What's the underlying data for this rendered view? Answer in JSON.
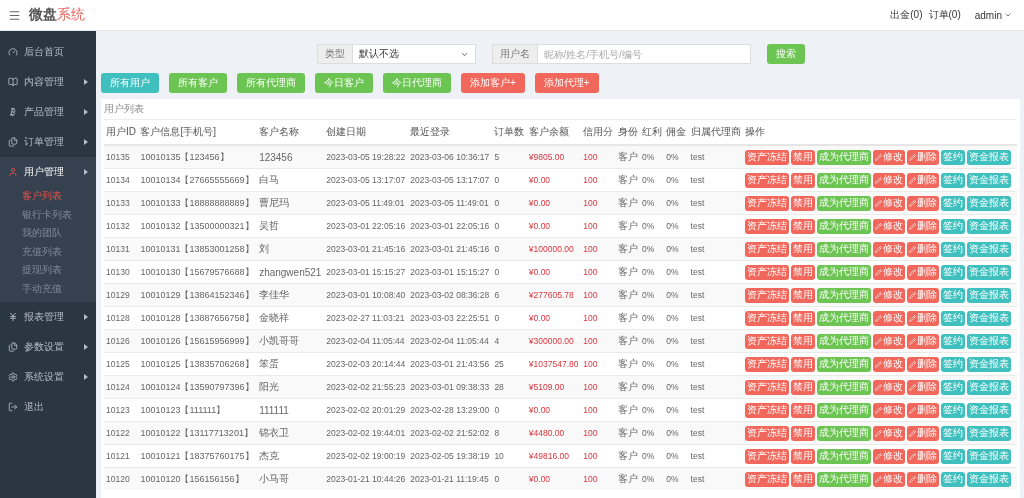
{
  "header": {
    "logo": {
      "main": "微盘",
      "accent": "系统"
    },
    "links": [
      "出金(0)",
      "订单(0)"
    ],
    "user": "admin"
  },
  "sidebar": {
    "items": [
      {
        "label": "后台首页",
        "expandable": false,
        "expanded": false
      },
      {
        "label": "内容管理",
        "expandable": true,
        "expanded": false
      },
      {
        "label": "产品管理",
        "expandable": true,
        "expanded": false
      },
      {
        "label": "订单管理",
        "expandable": true,
        "expanded": false
      },
      {
        "label": "用户管理",
        "expandable": true,
        "expanded": true,
        "children": [
          {
            "label": "客户列表",
            "selected": true
          },
          {
            "label": "银行卡列表",
            "selected": false
          },
          {
            "label": "我的团队",
            "selected": false
          },
          {
            "label": "充值列表",
            "selected": false
          },
          {
            "label": "提现列表",
            "selected": false
          },
          {
            "label": "手动充值",
            "selected": false
          }
        ]
      },
      {
        "label": "报表管理",
        "expandable": true,
        "expanded": false
      },
      {
        "label": "参数设置",
        "expandable": true,
        "expanded": false
      },
      {
        "label": "系统设置",
        "expandable": true,
        "expanded": false
      },
      {
        "label": "退出",
        "expandable": false,
        "expanded": false
      }
    ]
  },
  "filter": {
    "type_label": "类型",
    "type_value": "默认不选",
    "name_label": "用户名",
    "placeholder": "昵称/姓名/手机号/编号",
    "search": "搜索"
  },
  "quick_buttons": [
    {
      "label": "所有用户",
      "kind": "info"
    },
    {
      "label": "所有客户",
      "kind": "ok"
    },
    {
      "label": "所有代理商",
      "kind": "ok"
    },
    {
      "label": "今日客户",
      "kind": "ok"
    },
    {
      "label": "今日代理商",
      "kind": "ok"
    },
    {
      "label": "添加客户+",
      "kind": "warn"
    },
    {
      "label": "添加代理+",
      "kind": "warn"
    }
  ],
  "table": {
    "title": "用户列表",
    "columns": [
      "用户ID",
      "客户信息[手机号]",
      "客户名称",
      "创建日期",
      "最近登录",
      "订单数",
      "客户余额",
      "信用分",
      "身份",
      "红利",
      "佣金",
      "归属代理商",
      "操作"
    ],
    "rows": [
      {
        "cells": [
          "10135",
          "10010135【123456】",
          "123456",
          "2023-03-05 19:28:22",
          "2023-03-06 10:36:17",
          "5",
          "¥9805.00",
          "100",
          "客户",
          "0%",
          "0%",
          "test"
        ],
        "actions": [
          {
            "label": "资产冻结",
            "kind": "warn"
          },
          {
            "label": "禁用",
            "kind": "warn"
          },
          {
            "label": "成为代理商",
            "kind": "ok"
          },
          {
            "label": "修改",
            "kind": "edit"
          },
          {
            "label": "删除",
            "kind": "edit"
          },
          {
            "label": "签约",
            "kind": "info"
          },
          {
            "label": "资金报表",
            "kind": "info"
          }
        ]
      },
      {
        "cells": [
          "10134",
          "10010134【27665555669】",
          "白马",
          "2023-03-05 13:17:07",
          "2023-03-05 13:17:07",
          "0",
          "¥0.00",
          "100",
          "客户",
          "0%",
          "0%",
          "test"
        ],
        "actions": [
          {
            "label": "资产冻结",
            "kind": "warn"
          },
          {
            "label": "禁用",
            "kind": "warn"
          },
          {
            "label": "成为代理商",
            "kind": "ok"
          },
          {
            "label": "修改",
            "kind": "edit"
          },
          {
            "label": "删除",
            "kind": "edit"
          },
          {
            "label": "签约",
            "kind": "info"
          },
          {
            "label": "资金报表",
            "kind": "info"
          }
        ]
      },
      {
        "cells": [
          "10133",
          "10010133【18888888889】",
          "曹尼玛",
          "2023-03-05 11:49:01",
          "2023-03-05 11:49:01",
          "0",
          "¥0.00",
          "100",
          "客户",
          "0%",
          "0%",
          "test"
        ],
        "actions": [
          {
            "label": "资产冻结",
            "kind": "warn"
          },
          {
            "label": "禁用",
            "kind": "warn"
          },
          {
            "label": "成为代理商",
            "kind": "ok"
          },
          {
            "label": "修改",
            "kind": "edit"
          },
          {
            "label": "删除",
            "kind": "edit"
          },
          {
            "label": "签约",
            "kind": "info"
          },
          {
            "label": "资金报表",
            "kind": "info"
          }
        ]
      },
      {
        "cells": [
          "10132",
          "10010132【13500000321】",
          "吴哲",
          "2023-03-01 22:05:16",
          "2023-03-01 22:05:16",
          "0",
          "¥0.00",
          "100",
          "客户",
          "0%",
          "0%",
          "test"
        ],
        "actions": [
          {
            "label": "资产冻结",
            "kind": "warn"
          },
          {
            "label": "禁用",
            "kind": "warn"
          },
          {
            "label": "成为代理商",
            "kind": "ok"
          },
          {
            "label": "修改",
            "kind": "edit"
          },
          {
            "label": "删除",
            "kind": "edit"
          },
          {
            "label": "签约",
            "kind": "info"
          },
          {
            "label": "资金报表",
            "kind": "info"
          }
        ]
      },
      {
        "cells": [
          "10131",
          "10010131【13853001258】",
          "刘",
          "2023-03-01 21:45:16",
          "2023-03-01 21:45:16",
          "0",
          "¥100000.00",
          "100",
          "客户",
          "0%",
          "0%",
          "test"
        ],
        "actions": [
          {
            "label": "资产冻结",
            "kind": "warn"
          },
          {
            "label": "禁用",
            "kind": "warn"
          },
          {
            "label": "成为代理商",
            "kind": "ok"
          },
          {
            "label": "修改",
            "kind": "edit"
          },
          {
            "label": "删除",
            "kind": "edit"
          },
          {
            "label": "签约",
            "kind": "info"
          },
          {
            "label": "资金报表",
            "kind": "info"
          }
        ]
      },
      {
        "cells": [
          "10130",
          "10010130【15679576688】",
          "zhangwen521",
          "2023-03-01 15:15:27",
          "2023-03-01 15:15:27",
          "0",
          "¥0.00",
          "100",
          "客户",
          "0%",
          "0%",
          "test"
        ],
        "actions": [
          {
            "label": "资产冻结",
            "kind": "warn"
          },
          {
            "label": "禁用",
            "kind": "warn"
          },
          {
            "label": "成为代理商",
            "kind": "ok"
          },
          {
            "label": "修改",
            "kind": "edit"
          },
          {
            "label": "删除",
            "kind": "edit"
          },
          {
            "label": "签约",
            "kind": "info"
          },
          {
            "label": "资金报表",
            "kind": "info"
          }
        ]
      },
      {
        "cells": [
          "10129",
          "10010129【13864152346】",
          "李佳华",
          "2023-03-01 10:08:40",
          "2023-03-02 08:36:28",
          "6",
          "¥277605.78",
          "100",
          "客户",
          "0%",
          "0%",
          "test"
        ],
        "actions": [
          {
            "label": "资产冻结",
            "kind": "warn"
          },
          {
            "label": "禁用",
            "kind": "warn"
          },
          {
            "label": "成为代理商",
            "kind": "ok"
          },
          {
            "label": "修改",
            "kind": "edit"
          },
          {
            "label": "删除",
            "kind": "edit"
          },
          {
            "label": "签约",
            "kind": "info"
          },
          {
            "label": "资金报表",
            "kind": "info"
          }
        ]
      },
      {
        "cells": [
          "10128",
          "10010128【13887656758】",
          "金晓祥",
          "2023-02-27 11:03:21",
          "2023-03-03 22:25:51",
          "0",
          "¥0.00",
          "100",
          "客户",
          "0%",
          "0%",
          "test"
        ],
        "actions": [
          {
            "label": "资产冻结",
            "kind": "warn"
          },
          {
            "label": "禁用",
            "kind": "warn"
          },
          {
            "label": "成为代理商",
            "kind": "ok"
          },
          {
            "label": "修改",
            "kind": "edit"
          },
          {
            "label": "删除",
            "kind": "edit"
          },
          {
            "label": "签约",
            "kind": "info"
          },
          {
            "label": "资金报表",
            "kind": "info"
          }
        ]
      },
      {
        "cells": [
          "10126",
          "10010126【15615956999】",
          "小凯哥哥",
          "2023-02-04 11:05:44",
          "2023-02-04 11:05:44",
          "4",
          "¥300000.00",
          "100",
          "客户",
          "0%",
          "0%",
          "test"
        ],
        "actions": [
          {
            "label": "资产冻结",
            "kind": "warn"
          },
          {
            "label": "禁用",
            "kind": "warn"
          },
          {
            "label": "成为代理商",
            "kind": "ok"
          },
          {
            "label": "修改",
            "kind": "edit"
          },
          {
            "label": "删除",
            "kind": "edit"
          },
          {
            "label": "签约",
            "kind": "info"
          },
          {
            "label": "资金报表",
            "kind": "info"
          }
        ]
      },
      {
        "cells": [
          "10125",
          "10010125【13835706268】",
          "笨蛋",
          "2023-02-03 20:14:44",
          "2023-03-01 21:43:56",
          "25",
          "¥1037547.80",
          "100",
          "客户",
          "0%",
          "0%",
          "test"
        ],
        "actions": [
          {
            "label": "资产冻结",
            "kind": "warn"
          },
          {
            "label": "禁用",
            "kind": "warn"
          },
          {
            "label": "成为代理商",
            "kind": "ok"
          },
          {
            "label": "修改",
            "kind": "edit"
          },
          {
            "label": "删除",
            "kind": "edit"
          },
          {
            "label": "签约",
            "kind": "info"
          },
          {
            "label": "资金报表",
            "kind": "info"
          }
        ]
      },
      {
        "cells": [
          "10124",
          "10010124【13590797396】",
          "阳光",
          "2023-02-02 21:55:23",
          "2023-03-01 09:38:33",
          "28",
          "¥5109.00",
          "100",
          "客户",
          "0%",
          "0%",
          "test"
        ],
        "actions": [
          {
            "label": "资产冻结",
            "kind": "warn"
          },
          {
            "label": "禁用",
            "kind": "warn"
          },
          {
            "label": "成为代理商",
            "kind": "ok"
          },
          {
            "label": "修改",
            "kind": "edit"
          },
          {
            "label": "删除",
            "kind": "edit"
          },
          {
            "label": "签约",
            "kind": "info"
          },
          {
            "label": "资金报表",
            "kind": "info"
          }
        ]
      },
      {
        "cells": [
          "10123",
          "10010123【111111】",
          "111111",
          "2023-02-02 20:01:29",
          "2023-02-28 13:29:00",
          "0",
          "¥0.00",
          "100",
          "客户",
          "0%",
          "0%",
          "test"
        ],
        "actions": [
          {
            "label": "资产冻结",
            "kind": "warn"
          },
          {
            "label": "禁用",
            "kind": "warn"
          },
          {
            "label": "成为代理商",
            "kind": "ok"
          },
          {
            "label": "修改",
            "kind": "edit"
          },
          {
            "label": "删除",
            "kind": "edit"
          },
          {
            "label": "签约",
            "kind": "info"
          },
          {
            "label": "资金报表",
            "kind": "info"
          }
        ]
      },
      {
        "cells": [
          "10122",
          "10010122【13117713201】",
          "锦衣卫",
          "2023-02-02 19:44:01",
          "2023-02-02 21:52:02",
          "8",
          "¥4480.00",
          "100",
          "客户",
          "0%",
          "0%",
          "test"
        ],
        "actions": [
          {
            "label": "资产冻结",
            "kind": "warn"
          },
          {
            "label": "禁用",
            "kind": "warn"
          },
          {
            "label": "成为代理商",
            "kind": "ok"
          },
          {
            "label": "修改",
            "kind": "edit"
          },
          {
            "label": "删除",
            "kind": "edit"
          },
          {
            "label": "签约",
            "kind": "info"
          },
          {
            "label": "资金报表",
            "kind": "info"
          }
        ]
      },
      {
        "cells": [
          "10121",
          "10010121【18375760175】",
          "杰克",
          "2023-02-02 19:00:19",
          "2023-02-05 19:38:19",
          "10",
          "¥49816.00",
          "100",
          "客户",
          "0%",
          "0%",
          "test"
        ],
        "actions": [
          {
            "label": "资产冻结",
            "kind": "warn"
          },
          {
            "label": "禁用",
            "kind": "warn"
          },
          {
            "label": "成为代理商",
            "kind": "ok"
          },
          {
            "label": "修改",
            "kind": "edit"
          },
          {
            "label": "删除",
            "kind": "edit"
          },
          {
            "label": "签约",
            "kind": "info"
          },
          {
            "label": "资金报表",
            "kind": "info"
          }
        ]
      },
      {
        "cells": [
          "10120",
          "10010120【156156156】",
          "小马哥",
          "2023-01-21 10:44:26",
          "2023-01-21 11:19:45",
          "0",
          "¥0.00",
          "100",
          "客户",
          "0%",
          "0%",
          "test"
        ],
        "actions": [
          {
            "label": "资产冻结",
            "kind": "warn"
          },
          {
            "label": "禁用",
            "kind": "warn"
          },
          {
            "label": "成为代理商",
            "kind": "ok"
          },
          {
            "label": "修改",
            "kind": "edit"
          },
          {
            "label": "删除",
            "kind": "edit"
          },
          {
            "label": "签约",
            "kind": "info"
          },
          {
            "label": "资金报表",
            "kind": "info"
          }
        ]
      }
    ]
  }
}
